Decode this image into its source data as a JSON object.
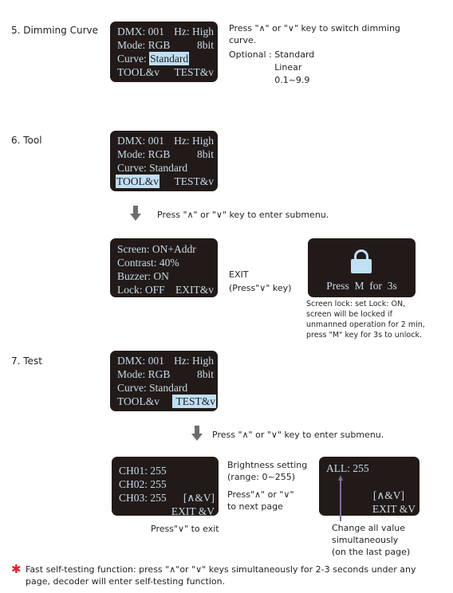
{
  "sections": {
    "dimming_curve": {
      "title": "5. Dimming Curve",
      "lcd": {
        "row1": [
          "DMX: 001",
          "Hz: High"
        ],
        "row2": [
          "Mode: RGB",
          "8bit"
        ],
        "row3_label": "Curve: ",
        "row3_value": "Standard",
        "row4": [
          "TOOL&v",
          "TEST&v"
        ],
        "highlighted": "Curve value"
      },
      "description_line1": "Press \"∧\" or \"∨\" key to switch dimming",
      "description_line2": "curve.",
      "optional_label": "Optional : ",
      "options": [
        "Standard",
        "Linear",
        "0.1~9.9"
      ]
    },
    "tool": {
      "title": "6. Tool",
      "lcd": {
        "row1": [
          "DMX: 001",
          "Hz: High"
        ],
        "row2": [
          "Mode: RGB",
          "8bit"
        ],
        "row3": "Curve: Standard",
        "row4": [
          "TOOL&v",
          "TEST&v"
        ],
        "highlighted": "TOOL&v"
      },
      "arrow_text": "Press \"∧\" or \"∨\" key to enter submenu.",
      "submenu_lcd": {
        "row1": "Screen: ON+Addr",
        "row2": "Contrast: 40%",
        "row3": "Buzzer: ON",
        "row4": [
          "Lock: OFF",
          "EXIT&v"
        ]
      },
      "exit_label": "EXIT",
      "exit_hint": "(Press\"∨\" key)",
      "lock_lcd": {
        "icon": "lock-icon",
        "text": "Press  M  for  3s"
      },
      "lock_note": [
        "Screen lock: set Lock: ON,",
        "screen will be locked if",
        "unmanned operation for 2 min,",
        "press \"M\" key for 3s to unlock."
      ]
    },
    "test": {
      "title": "7. Test",
      "lcd": {
        "row1": [
          "DMX: 001",
          "Hz: High"
        ],
        "row2": [
          "Mode: RGB",
          "8bit"
        ],
        "row3": "Curve: Standard",
        "row4": [
          "TOOL&v",
          "TEST&v"
        ],
        "highlighted": "TEST&v"
      },
      "arrow_text": "Press \"∧\" or \"∨\" key to enter submenu.",
      "channels_lcd": {
        "row1": "CH01: 255",
        "row2": "CH02: 255",
        "row3": [
          "CH03: 255",
          "[∧&V]"
        ],
        "row4": "EXIT &V"
      },
      "brightness_note": [
        "Brightness setting",
        "(range: 0~255)"
      ],
      "next_page_note": [
        "Press\"∧\" or \"∨\"",
        "to next page"
      ],
      "exit_note": "Press\"∨\" to exit",
      "all_lcd": {
        "row1": "ALL: 255",
        "row3": "[∧&V]",
        "row4": "EXIT &V"
      },
      "all_note": [
        "Change all value",
        "simultaneously",
        "(on the last page)"
      ]
    }
  },
  "footnote": {
    "symbol": "✱",
    "line1": "Fast self-testing function: press \"∧\"or \"∨\" keys simultaneously for 2-3 seconds under any",
    "line2": "page, decoder will enter self-testing function."
  },
  "colors": {
    "lcd_background": "#221a18",
    "lcd_text": "#c8dcea",
    "highlight": "#bfe0f5",
    "arrow": "#6d6e71",
    "pointer": "#7b6f9a",
    "asterisk": "#e8202a"
  }
}
